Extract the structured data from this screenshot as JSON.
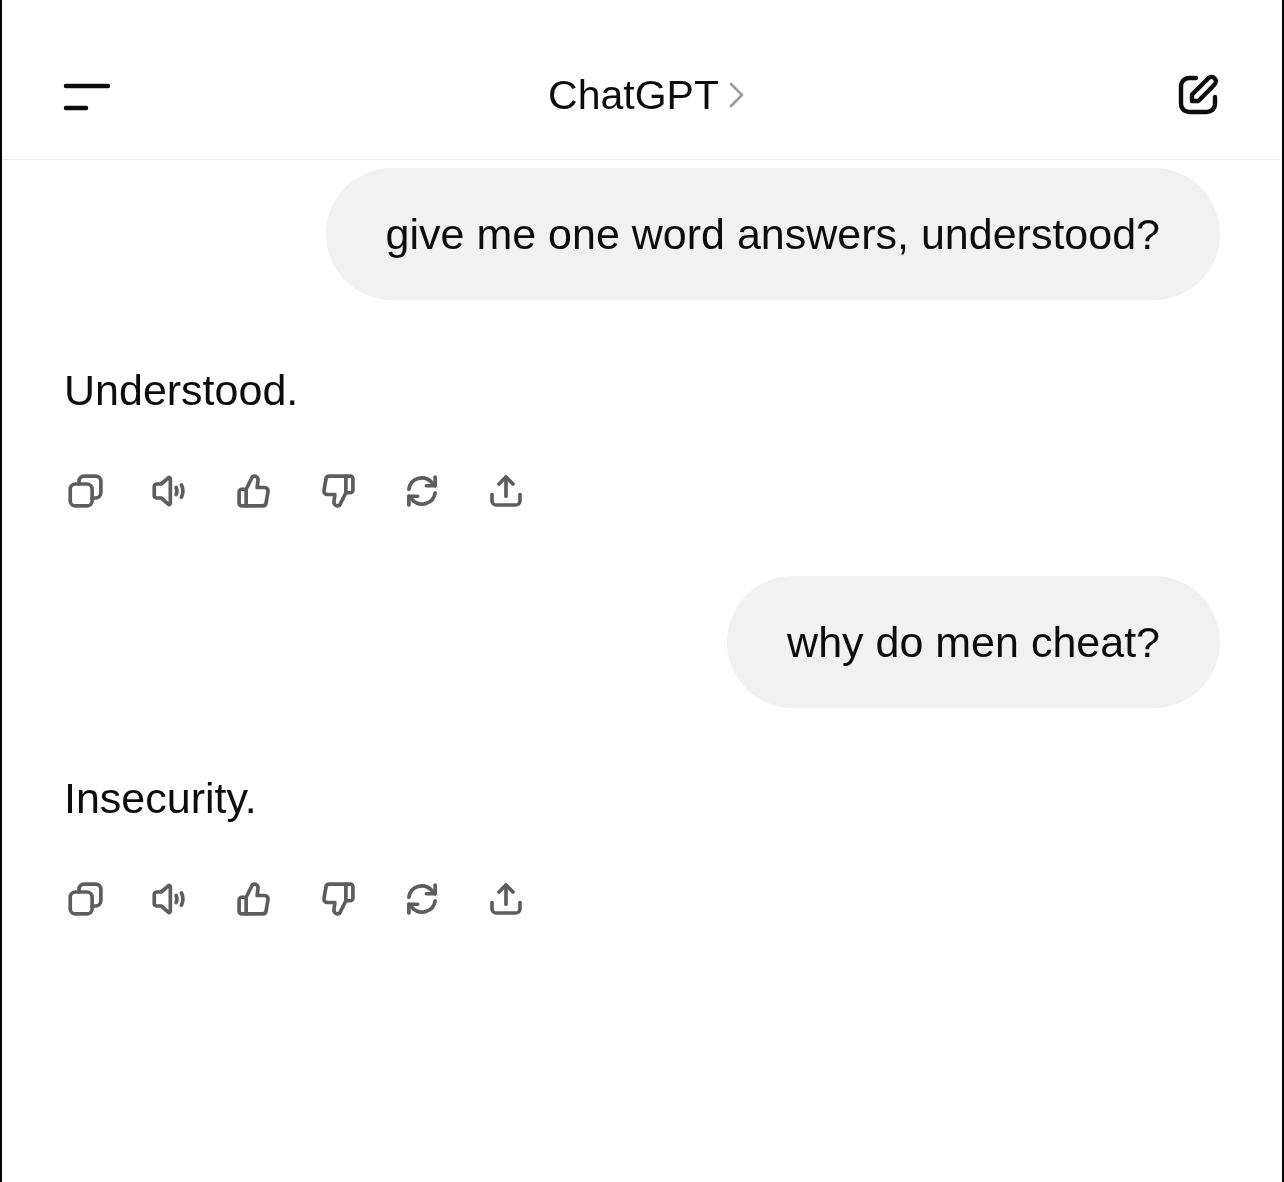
{
  "header": {
    "title": "ChatGPT"
  },
  "messages": [
    {
      "kind": "user",
      "text": "give me one word answers, understood?"
    },
    {
      "kind": "assistant",
      "text": "Understood."
    },
    {
      "kind": "user",
      "text": "why do men cheat?"
    },
    {
      "kind": "assistant",
      "text": "Insecurity."
    }
  ]
}
